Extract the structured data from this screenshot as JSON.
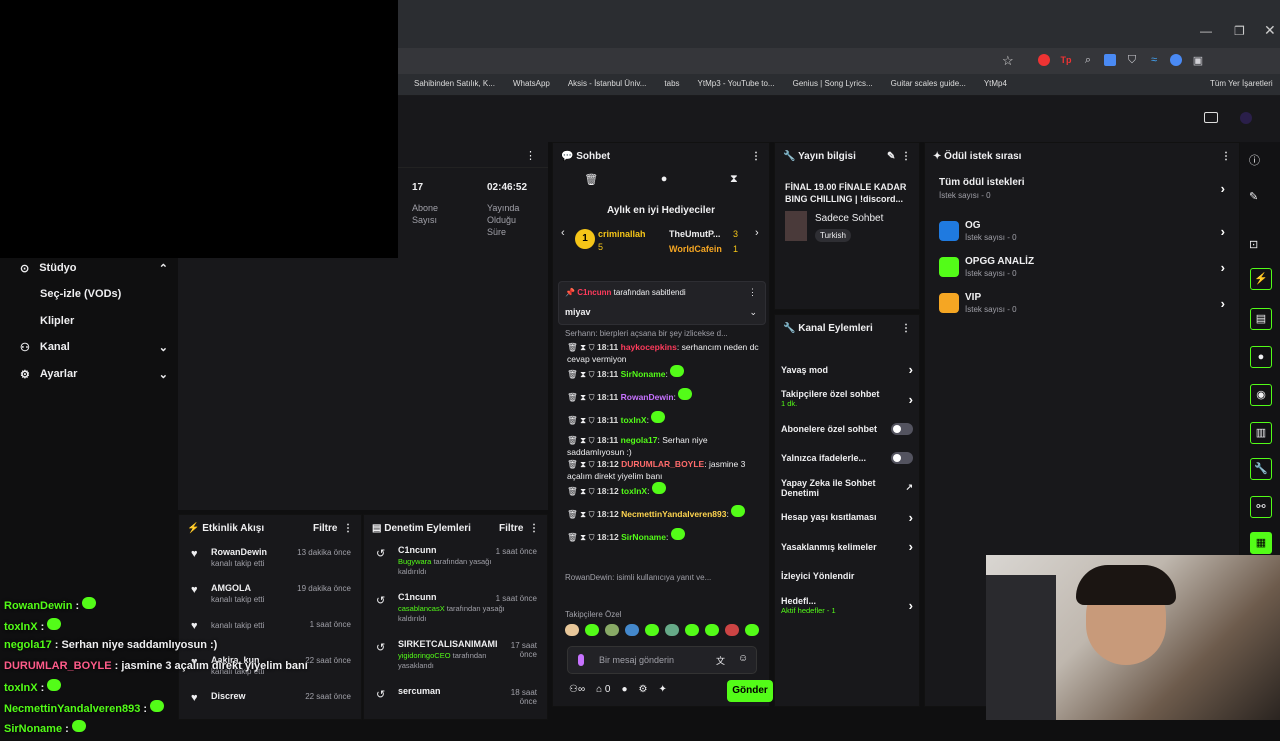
{
  "bookmarks": [
    "Sahibinden Satılık, K...",
    "WhatsApp",
    "Aksis - İstanbul Üniv...",
    "tabs",
    "YtMp3 - YouTube to...",
    "Genius | Song Lyrics...",
    "Guitar scales guide...",
    "YtMp4",
    "Tüm Yer İşaretleri"
  ],
  "sidebar": {
    "items": [
      {
        "label": "Stüdyo"
      },
      {
        "label": "Seç-izle (VODs)"
      },
      {
        "label": "Klipler"
      },
      {
        "label": "Kanal"
      },
      {
        "label": "Ayarlar"
      }
    ]
  },
  "stats": {
    "subs_value": "17",
    "subs_label": "Abone Sayısı",
    "time_value": "02:46:52",
    "time_label": "Yayında Olduğu Süre"
  },
  "activity": {
    "title": "Etkinlik Akışı",
    "filter": "Filtre",
    "items": [
      {
        "name": "RowanDewin",
        "sub": "kanalı takip etti",
        "time": "13 dakika önce"
      },
      {
        "name": "AMGOLA",
        "sub": "kanalı takip etti",
        "time": "19 dakika önce"
      },
      {
        "name": "",
        "sub": "kanalı takip etti",
        "time": "1 saat önce"
      },
      {
        "name": "Aakira_kun",
        "sub": "kanalı takip etti",
        "time": "22 saat önce"
      },
      {
        "name": "Discrew",
        "sub": "",
        "time": "22 saat önce"
      }
    ]
  },
  "moderation": {
    "title": "Denetim Eylemleri",
    "filter": "Filtre",
    "items": [
      {
        "name": "C1ncunn",
        "target": "Bugywara",
        "rest": "tarafından yasağı kaldırıldı",
        "time": "1 saat önce"
      },
      {
        "name": "C1ncunn",
        "target": "casablancasX",
        "rest": "tarafından yasağı kaldırıldı",
        "time": "1 saat önce"
      },
      {
        "name": "SIRKETCALISANIMAMI",
        "target": "yigidoringoCEO",
        "rest": "tarafından yasaklandı",
        "time": "17 saat önce"
      },
      {
        "name": "sercuman",
        "target": "",
        "rest": "",
        "time": "18 saat önce"
      }
    ]
  },
  "chat": {
    "title": "Sohbet",
    "gifters_title": "Aylık en iyi Hediyeciler",
    "gifters": [
      {
        "name": "criminallah",
        "count": "5"
      },
      {
        "name": "TheUmutP...",
        "count": "3"
      },
      {
        "name": "WorldCafein",
        "count": "1"
      }
    ],
    "pinned_by": "C1ncunn",
    "pinned_label": "tarafından sabitlendi",
    "pinned_msg": "miyav",
    "reply_preview": "Serhann: bierpleri açsana bir şey izlicekse d...",
    "messages": [
      {
        "time": "18:11",
        "user": "haykocepkins",
        "color": "#ff3b5c",
        "text": "serhancım neden dc cevap vermiyon"
      },
      {
        "time": "18:11",
        "user": "SirNoname",
        "color": "#53fc18",
        "text": ""
      },
      {
        "time": "18:11",
        "user": "RowanDewin",
        "color": "#c772ff",
        "text": ""
      },
      {
        "time": "18:11",
        "user": "toxInX",
        "color": "#53fc18",
        "text": ""
      },
      {
        "time": "18:11",
        "user": "negola17",
        "color": "#53fc18",
        "text": "Serhan niye saddamlıyosun :)"
      },
      {
        "time": "18:12",
        "user": "DURUMLAR_BOYLE",
        "color": "#ff6b6b",
        "text": "jasmine 3 açalım direkt yiyelim banı"
      },
      {
        "time": "18:12",
        "user": "toxInX",
        "color": "#53fc18",
        "text": ""
      },
      {
        "time": "18:12",
        "user": "NecmettinYandalveren893",
        "color": "#ffd54f",
        "text": ""
      },
      {
        "time": "18:12",
        "user": "SirNoname",
        "color": "#53fc18",
        "text": ""
      }
    ],
    "reply2": "RowanDewin: isimli kullanıcıya yanıt ve...",
    "followers_label": "Takipçilere Özel",
    "input_placeholder": "Bir mesaj gönderin",
    "send": "Gönder",
    "points": "0"
  },
  "stream_info": {
    "title": "Yayın bilgisi",
    "stream_title": "FİNAL 19.00 FİNALE KADAR BING CHILLING | !discord...",
    "category": "Sadece Sohbet",
    "tag": "Turkish"
  },
  "channel_actions": {
    "title": "Kanal Eylemleri",
    "items": [
      {
        "label": "Yavaş mod",
        "sub": ""
      },
      {
        "label": "Takipçilere özel sohbet",
        "sub": "1 dk."
      },
      {
        "label": "Abonelere özel sohbet",
        "sub": ""
      },
      {
        "label": "Yalnızca ifadelerle...",
        "sub": ""
      },
      {
        "label": "Yapay Zeka ile Sohbet Denetimi",
        "sub": ""
      },
      {
        "label": "Hesap yaşı kısıtlaması",
        "sub": ""
      },
      {
        "label": "Yasaklanmış kelimeler",
        "sub": ""
      },
      {
        "label": "İzleyici Yönlendir",
        "sub": ""
      },
      {
        "label": "Hedefl...",
        "sub": "Aktif hedefler - 1"
      }
    ]
  },
  "rewards": {
    "title": "Ödül istek sırası",
    "all": "Tüm ödül istekleri",
    "all_sub": "İstek sayısı - 0",
    "items": [
      {
        "name": "OG",
        "sub": "İstek sayısı - 0",
        "color": "#1f7ae0"
      },
      {
        "name": "OPGG ANALİZ",
        "sub": "İstek sayısı - 0",
        "color": "#53fc18"
      },
      {
        "name": "VIP",
        "sub": "İstek sayısı - 0",
        "color": "#f5a623"
      }
    ]
  },
  "overlay_chat": [
    {
      "user": "RowanDewin",
      "color": "#53fc18",
      "text": ""
    },
    {
      "user": "toxInX",
      "color": "#53fc18",
      "text": ""
    },
    {
      "user": "negola17",
      "color": "#53fc18",
      "text": "Serhan niye saddamlıyosun :)"
    },
    {
      "user": "DURUMLAR_BOYLE",
      "color": "#ff5c8a",
      "text": "jasmine 3 açalım direkt yiyelim banı"
    },
    {
      "user": "toxInX",
      "color": "#53fc18",
      "text": ""
    },
    {
      "user": "NecmettinYandalveren893",
      "color": "#53fc18",
      "text": ""
    },
    {
      "user": "SirNoname",
      "color": "#53fc18",
      "text": ""
    }
  ]
}
